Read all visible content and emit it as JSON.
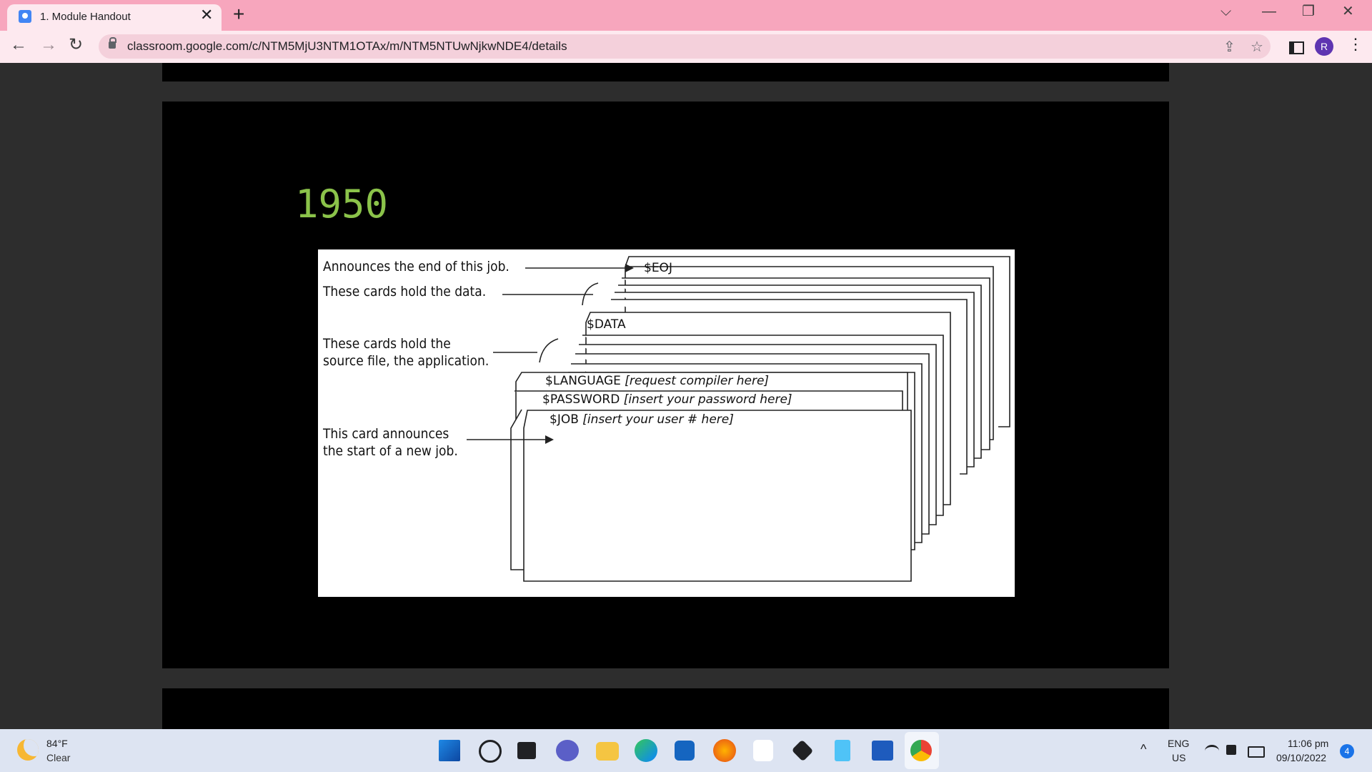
{
  "browser": {
    "tab_title": "1. Module Handout",
    "tab_close": "✕",
    "new_tab": "+",
    "url": "classroom.google.com/c/NTM5MjU3NTM1OTAx/m/NTM5NTUwNjkwNDE4/details",
    "profile_initial": "R",
    "back": "←",
    "forward": "→",
    "reload": "↻",
    "share": "⇪",
    "star": "☆",
    "menu": "⋮",
    "tab_search": "⌵",
    "minimize": "—",
    "restore": "❐",
    "close": "✕"
  },
  "slide": {
    "year": "1950",
    "labels": {
      "eoj": "Announces the end of this job.",
      "data_cards": "These cards hold the data.",
      "source_line1": "These cards hold the",
      "source_line2": "source file, the application.",
      "start_line1": "This card announces",
      "start_line2": "the start of a new job."
    },
    "cards": {
      "eoj": "$EOJ",
      "data": "$DATA",
      "language": "$LANGUAGE",
      "language_hint": "[request compiler here]",
      "password": "$PASSWORD",
      "password_hint": "[insert your password here]",
      "job": "$JOB",
      "job_hint": "[insert your user # here]"
    }
  },
  "taskbar": {
    "weather_temp": "84°F",
    "weather_condition": "Clear",
    "language_line1": "ENG",
    "language_line2": "US",
    "time": "11:06 pm",
    "date": "09/10/2022",
    "notifications": "4",
    "tray_chevron": "^",
    "apps": [
      "start",
      "search",
      "task-view",
      "teams-chat",
      "file-explorer",
      "edge",
      "store",
      "firefox",
      "amazon",
      "dropbox",
      "notepad",
      "word",
      "chrome"
    ]
  }
}
